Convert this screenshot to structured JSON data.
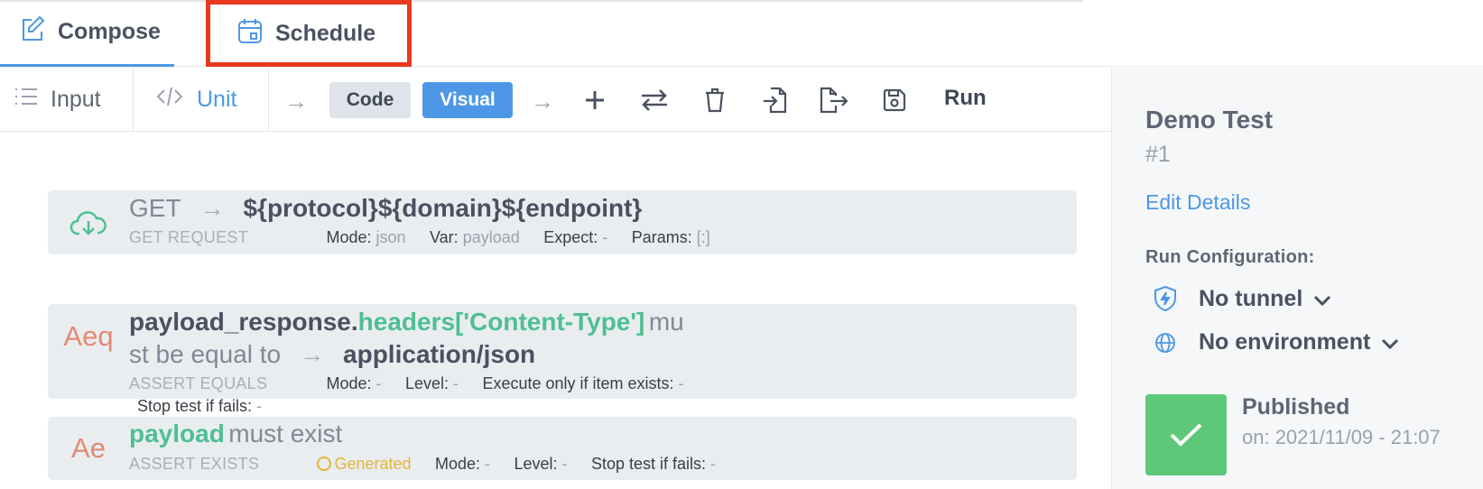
{
  "tabs": {
    "compose": "Compose",
    "schedule": "Schedule"
  },
  "toolbar": {
    "input": "Input",
    "unit": "Unit",
    "code": "Code",
    "visual": "Visual",
    "run": "Run",
    "arrow": "→",
    "icons": [
      "plus-icon",
      "swap-icon",
      "trash-icon",
      "import-icon",
      "export-icon",
      "save-icon"
    ]
  },
  "steps": [
    {
      "method": "GET",
      "arrow": "→",
      "url": "${protocol}${domain}${endpoint}",
      "type": "GET REQUEST",
      "mode_label": "Mode:",
      "mode_value": "json",
      "var_label": "Var:",
      "var_value": "payload",
      "expect_label": "Expect:",
      "expect_value": "-",
      "params_label": "Params:",
      "params_value": "[:]"
    },
    {
      "abbr": "Aeq",
      "subject": "payload_response.",
      "subject_key": "headers['Content-Type']",
      "verb_a": "mu",
      "verb_b": "st be equal to",
      "arrow": "→",
      "expected": "application/json",
      "type": "ASSERT EQUALS",
      "mode_label": "Mode:",
      "mode_value": "-",
      "level_label": "Level:",
      "level_value": "-",
      "exec_label": "Execute only if item exists:",
      "exec_value": "-",
      "stop_label": "Stop test if fails:",
      "stop_value": "-"
    },
    {
      "abbr": "Ae",
      "subject": "payload",
      "verb": "must exist",
      "type": "ASSERT EXISTS",
      "generated": "Generated",
      "mode_label": "Mode:",
      "mode_value": "-",
      "level_label": "Level:",
      "level_value": "-",
      "stop_label": "Stop test if fails:",
      "stop_value": "-"
    }
  ],
  "panel": {
    "title": "Demo Test",
    "number": "#1",
    "edit": "Edit Details",
    "run_config": "Run Configuration:",
    "tunnel": "No tunnel",
    "environment": "No environment",
    "published": "Published",
    "published_on": "on: 2021/11/09 - 21:07"
  },
  "colors": {
    "accent": "#4e97e6",
    "highlight": "#e8391f",
    "key_green": "#4fbf93",
    "assert_orange": "#e28a74",
    "published_green": "#5ec878",
    "generated_yellow": "#e5b53b"
  }
}
